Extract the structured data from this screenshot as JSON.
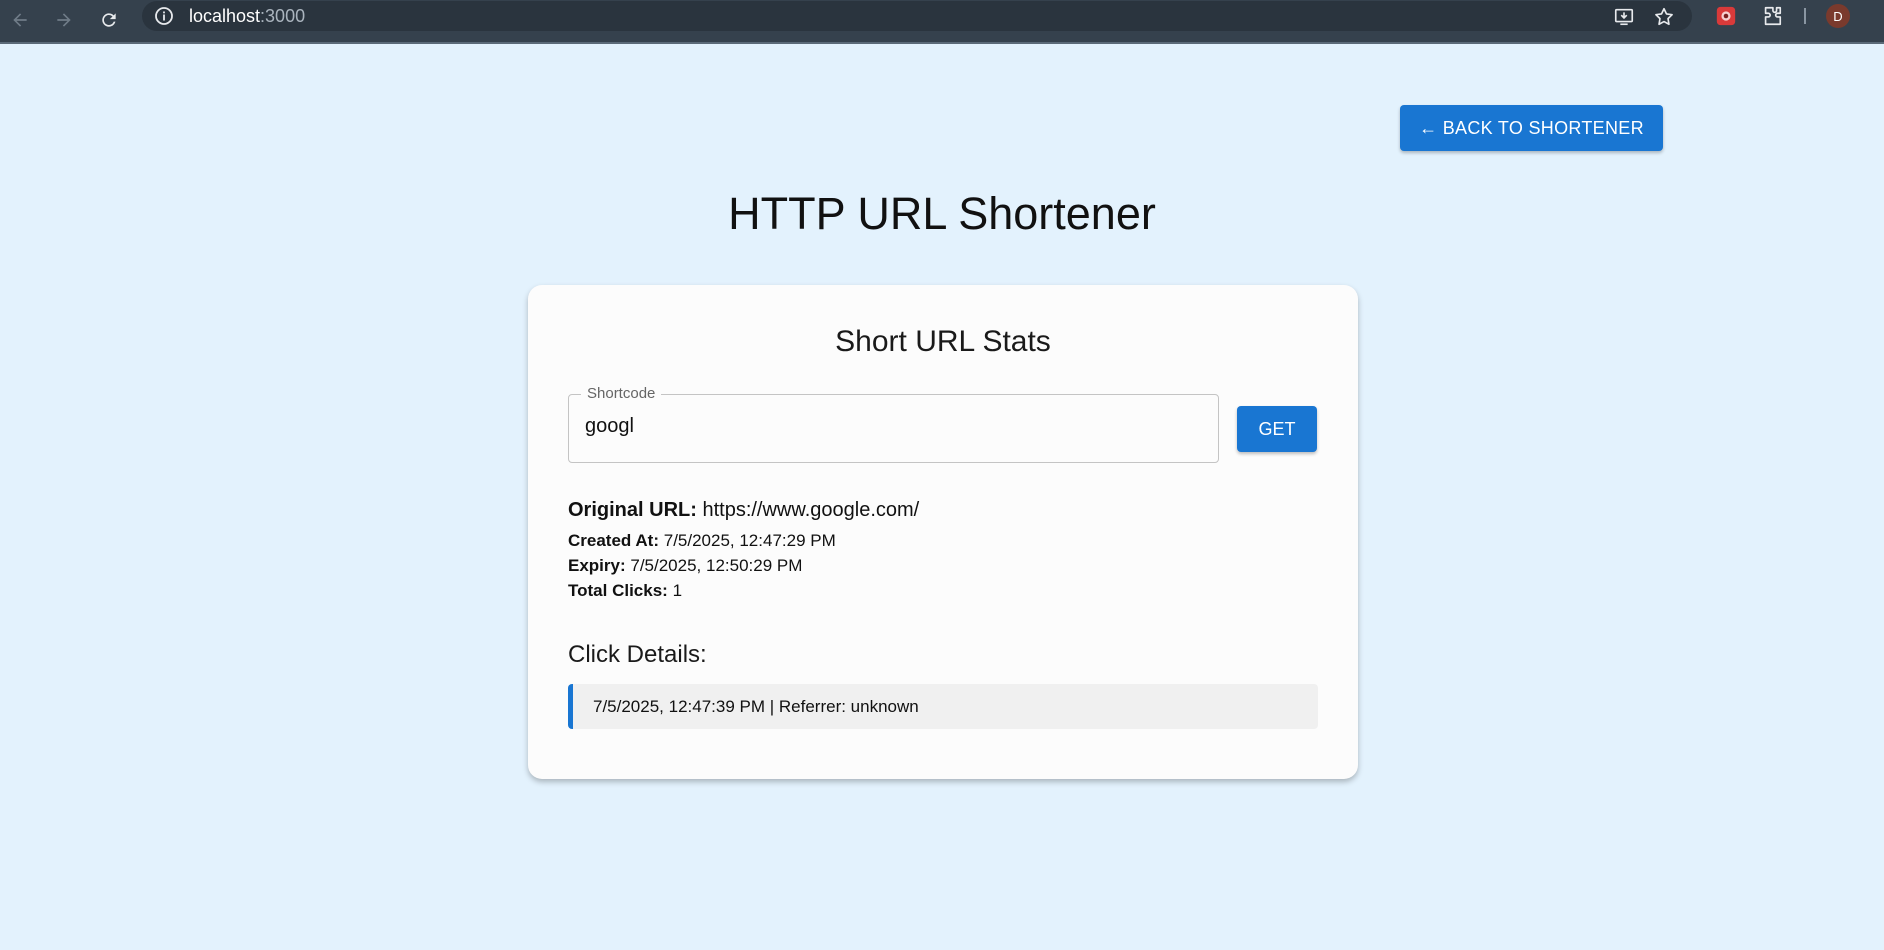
{
  "browser": {
    "url_host": "localhost",
    "url_port": ":3000",
    "profile_initial": "D"
  },
  "page": {
    "back_button_label": "← BACK TO SHORTENER",
    "title": "HTTP URL Shortener"
  },
  "card": {
    "title": "Short URL Stats",
    "shortcode_label": "Shortcode",
    "shortcode_value": "googl",
    "get_button_label": "GET",
    "original_url_label": "Original URL:",
    "original_url_value": "https://www.google.com/",
    "created_at_label": "Created At:",
    "created_at_value": "7/5/2025, 12:47:29 PM",
    "expiry_label": "Expiry:",
    "expiry_value": "7/5/2025, 12:50:29 PM",
    "total_clicks_label": "Total Clicks:",
    "total_clicks_value": "1",
    "click_details_title": "Click Details:",
    "clicks": [
      {
        "text": "7/5/2025, 12:47:39 PM | Referrer: unknown"
      }
    ]
  },
  "colors": {
    "primary": "#1976d2",
    "background": "#e3f2fd",
    "card": "#fcfcfc"
  }
}
